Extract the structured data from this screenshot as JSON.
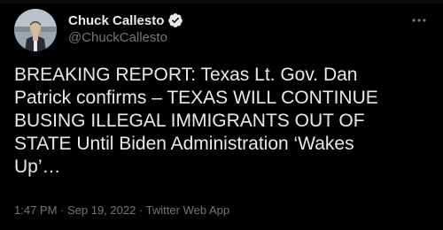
{
  "author": {
    "display_name": "Chuck Callesto",
    "handle": "@ChuckCallesto",
    "verified": true
  },
  "icons": {
    "verified": "verified-badge-icon",
    "more": "more-options-icon",
    "avatar": "profile-photo"
  },
  "tweet": {
    "text": "BREAKING REPORT: Texas Lt. Gov. Dan\nPatrick confirms – TEXAS WILL CONTINUE\nBUSING ILLEGAL IMMIGRANTS OUT OF\nSTATE Until Biden Administration ‘Wakes\nUp’…"
  },
  "meta": {
    "time": "1:47 PM",
    "separator_1": " · ",
    "date": "Sep 19, 2022",
    "separator_2": " · ",
    "source": "Twitter Web App"
  },
  "colors": {
    "background": "#000000",
    "text_primary": "#e7e9ea",
    "text_secondary": "#71767b",
    "verified_blue": "#1d9bf0"
  }
}
